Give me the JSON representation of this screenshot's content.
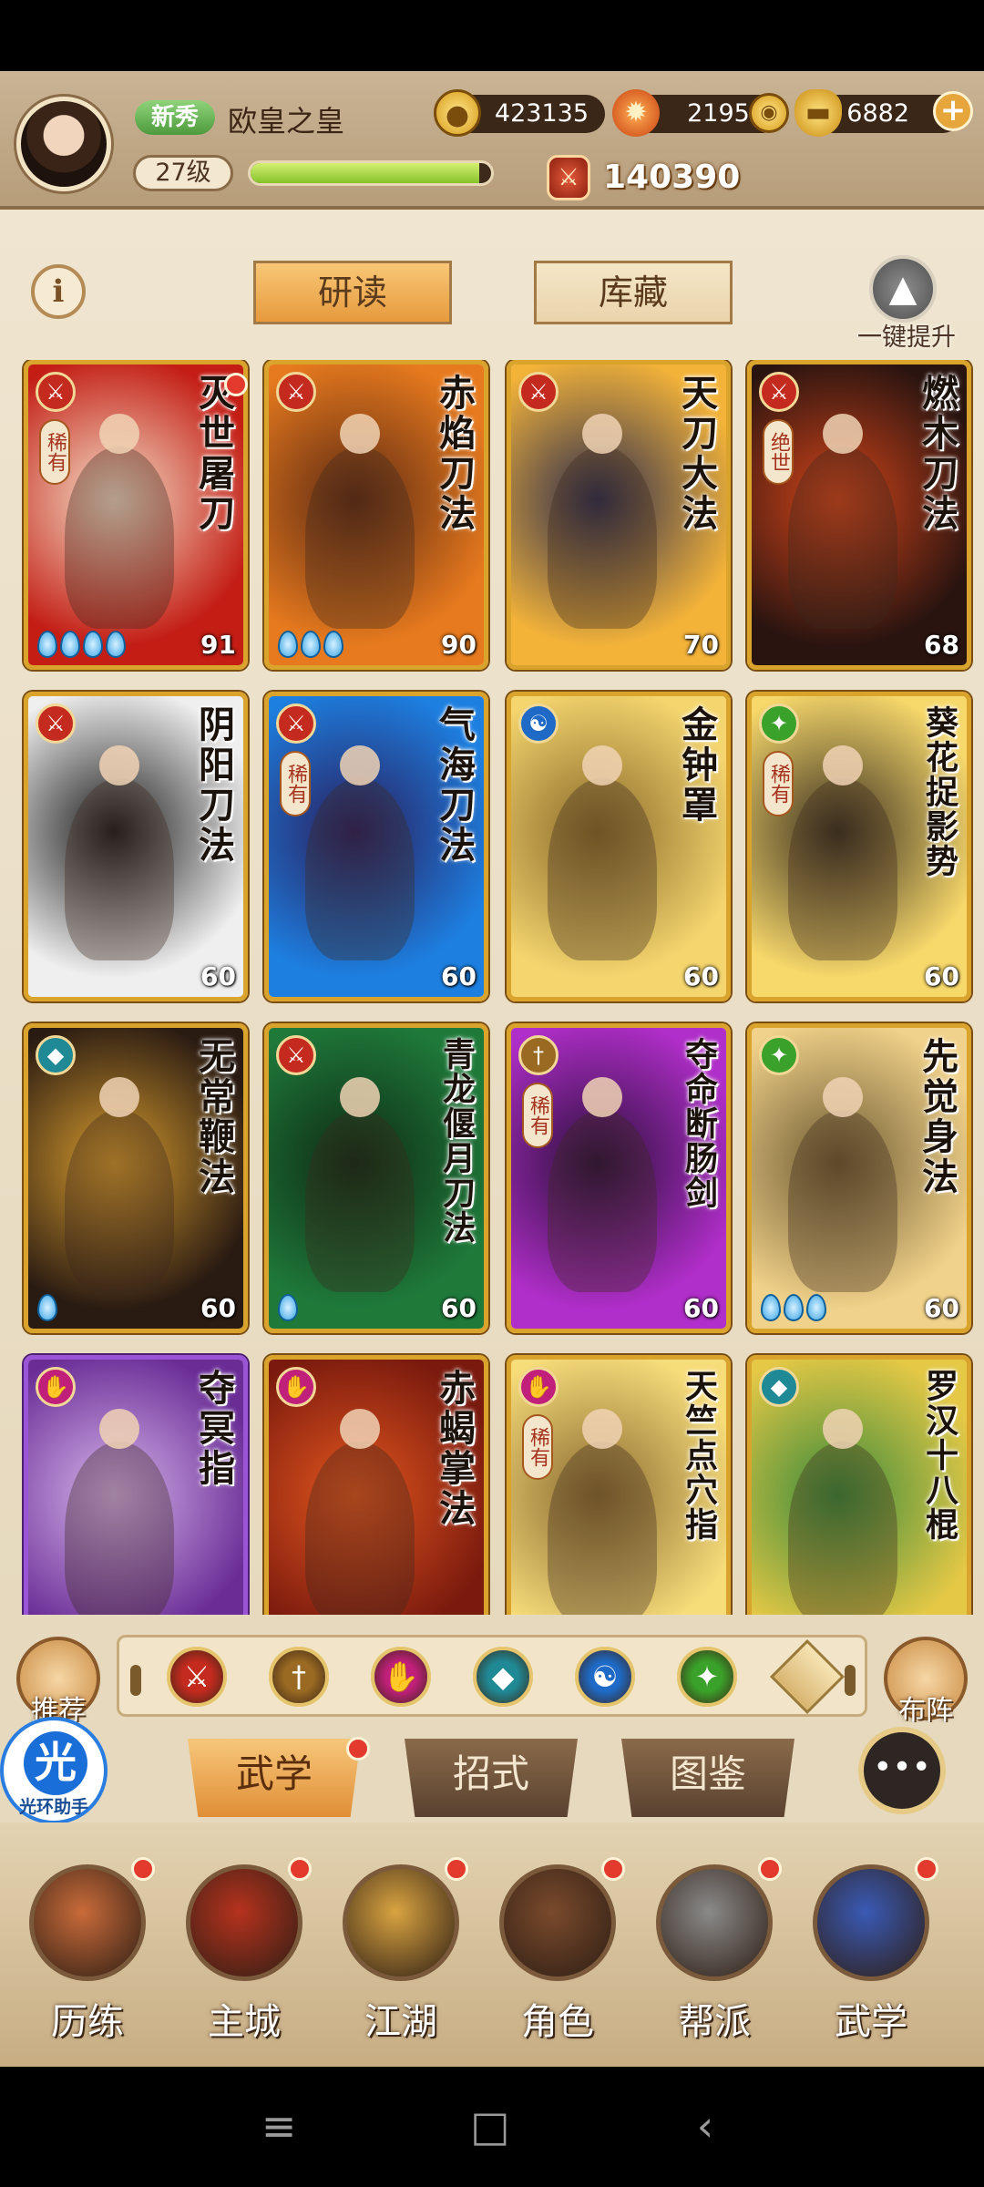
{
  "player": {
    "rank_badge": "新秀",
    "name": "欧皇之皇",
    "level": "27级",
    "exp_fraction": 0.95,
    "power": "140390"
  },
  "resources": {
    "coins": "423135",
    "flame": "21952",
    "ingot": "6882"
  },
  "top_tabs": {
    "study": "研读",
    "collection": "库藏"
  },
  "upgrade_label": "一键提升",
  "cards": [
    {
      "name": "灭世屠刀",
      "level": "91",
      "rarity": "稀有",
      "school": "blade",
      "drops": 4,
      "bg": [
        "#c31d14",
        "#f4e0c8"
      ]
    },
    {
      "name": "赤焰刀法",
      "level": "90",
      "rarity": "",
      "school": "blade",
      "drops": 3,
      "bg": [
        "#e77a1e",
        "#5e2a12"
      ]
    },
    {
      "name": "天刀大法",
      "level": "70",
      "rarity": "",
      "school": "blade",
      "drops": 0,
      "bg": [
        "#f3b339",
        "#2c2c4e"
      ]
    },
    {
      "name": "燃木刀法",
      "level": "68",
      "rarity": "绝世",
      "school": "blade",
      "drops": 0,
      "bg": [
        "#2a1410",
        "#d2441a"
      ]
    },
    {
      "name": "阴阳刀法",
      "level": "60",
      "rarity": "",
      "school": "blade",
      "drops": 0,
      "bg": [
        "#efefef",
        "#1b1b1b"
      ]
    },
    {
      "name": "气海刀法",
      "level": "60",
      "rarity": "稀有",
      "school": "blade",
      "drops": 0,
      "bg": [
        "#1d7fe0",
        "#2a1d5c"
      ]
    },
    {
      "name": "金钟罩",
      "level": "60",
      "rarity": "",
      "school": "inner",
      "drops": 0,
      "bg": [
        "#f4d56e",
        "#8a6a2a"
      ]
    },
    {
      "name": "葵花捉影势",
      "level": "60",
      "rarity": "稀有",
      "school": "agility",
      "drops": 0,
      "bg": [
        "#f7d86b",
        "#3a3020"
      ]
    },
    {
      "name": "无常鞭法",
      "level": "60",
      "rarity": "",
      "school": "whip",
      "drops": 1,
      "bg": [
        "#2a1b12",
        "#d59a2e"
      ]
    },
    {
      "name": "青龙偃月刀法",
      "level": "60",
      "rarity": "",
      "school": "blade",
      "drops": 1,
      "bg": [
        "#1f7a3a",
        "#0e2a14"
      ]
    },
    {
      "name": "夺命断肠剑",
      "level": "60",
      "rarity": "稀有",
      "school": "sword",
      "drops": 0,
      "bg": [
        "#b02ec9",
        "#2a0f3a"
      ]
    },
    {
      "name": "先觉身法",
      "level": "60",
      "rarity": "",
      "school": "agility",
      "drops": 3,
      "bg": [
        "#f1d28a",
        "#6e5a32"
      ]
    },
    {
      "name": "夺冥指",
      "level": "",
      "rarity": "",
      "school": "finger",
      "drops": 0,
      "bg": [
        "#6a2d96",
        "#d6b4ea"
      ]
    },
    {
      "name": "赤蝎掌法",
      "level": "",
      "rarity": "",
      "school": "finger",
      "drops": 0,
      "bg": [
        "#7a1a0e",
        "#e2561e"
      ]
    },
    {
      "name": "天竺点穴指",
      "level": "",
      "rarity": "稀有",
      "school": "finger",
      "drops": 0,
      "bg": [
        "#f7dc7a",
        "#8a6a30"
      ]
    },
    {
      "name": "罗汉十八棍",
      "level": "",
      "rarity": "",
      "school": "whip",
      "drops": 0,
      "bg": [
        "#e4c846",
        "#3a8a3a"
      ]
    }
  ],
  "side_buttons": {
    "recommend": "推荐",
    "formation": "布阵"
  },
  "filter_schools": [
    {
      "icon": "blade-school-icon",
      "color": "#c42a1e",
      "glyph": "⚔"
    },
    {
      "icon": "sword-school-icon",
      "color": "#9a6a22",
      "glyph": "†"
    },
    {
      "icon": "finger-school-icon",
      "color": "#c0207a",
      "glyph": "✋"
    },
    {
      "icon": "whip-school-icon",
      "color": "#1f8a96",
      "glyph": "◆"
    },
    {
      "icon": "inner-school-icon",
      "color": "#1e6ac6",
      "glyph": "☯"
    },
    {
      "icon": "agility-school-icon",
      "color": "#3aa12a",
      "glyph": "✦"
    }
  ],
  "helper": {
    "glyph": "光",
    "label": "光环助手"
  },
  "sub_tabs": {
    "martial": "武学",
    "moves": "招式",
    "codex": "图鉴"
  },
  "bottom_nav": [
    {
      "label": "历练",
      "color": "#c96b3a"
    },
    {
      "label": "主城",
      "color": "#b6321e"
    },
    {
      "label": "江湖",
      "color": "#d9a441"
    },
    {
      "label": "角色",
      "color": "#7a4a2c"
    },
    {
      "label": "帮派",
      "color": "#8a8a8a"
    },
    {
      "label": "武学",
      "color": "#3a5ab6"
    }
  ],
  "school_colors": {
    "blade": "#c42a1e",
    "sword": "#9a6a22",
    "finger": "#c0207a",
    "whip": "#1f8a96",
    "inner": "#1e6ac6",
    "agility": "#3aa12a"
  }
}
